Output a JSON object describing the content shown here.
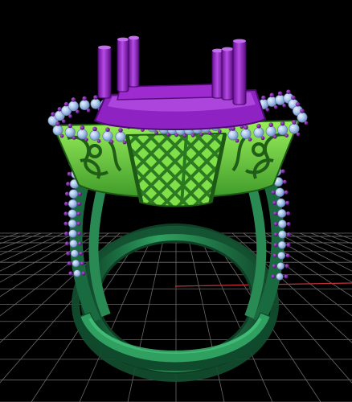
{
  "scene": {
    "subject": "ring-cad-render",
    "colors": {
      "background": "#000000",
      "grid_line": "#8a8a8a",
      "grid_axis": "#c0393b",
      "shank": "#1f7a4a",
      "shank_highlight": "#3fb070",
      "gallery": "#6ad43c",
      "gallery_dark": "#2f7f24",
      "prongs": "#8a18b8",
      "prongs_light": "#b043e0",
      "bezel": "#9d2bd0",
      "beads": "#6a1a8a",
      "gems": "#a9c6ea",
      "gems_dark": "#7f9fd0"
    }
  }
}
